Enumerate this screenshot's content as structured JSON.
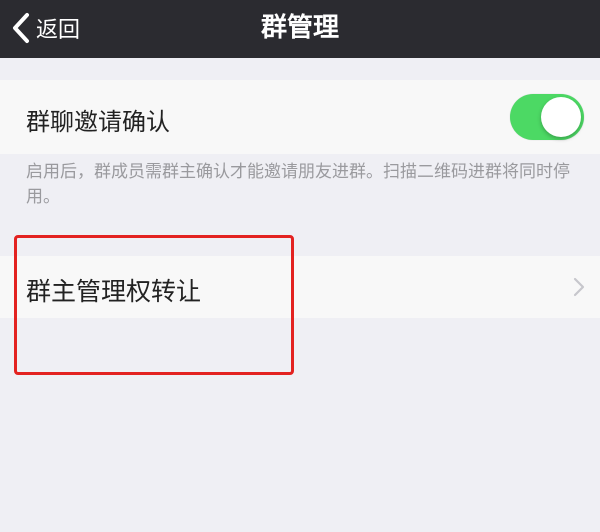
{
  "nav": {
    "back_label": "返回",
    "title": "群管理"
  },
  "settings": {
    "invite_confirm": {
      "label": "群聊邀请确认",
      "enabled": true
    },
    "footnote": "启用后，群成员需群主确认才能邀请朋友进群。扫描二维码进群将同时停用。",
    "transfer_owner": {
      "label": "群主管理权转让"
    }
  },
  "colors": {
    "nav_background": "#2b2b30",
    "toggle_on": "#4cd964",
    "highlight_box": "#e32220",
    "page_background": "#efeff4"
  },
  "icons": {
    "back": "chevron-left-icon",
    "disclosure": "chevron-right-icon"
  }
}
